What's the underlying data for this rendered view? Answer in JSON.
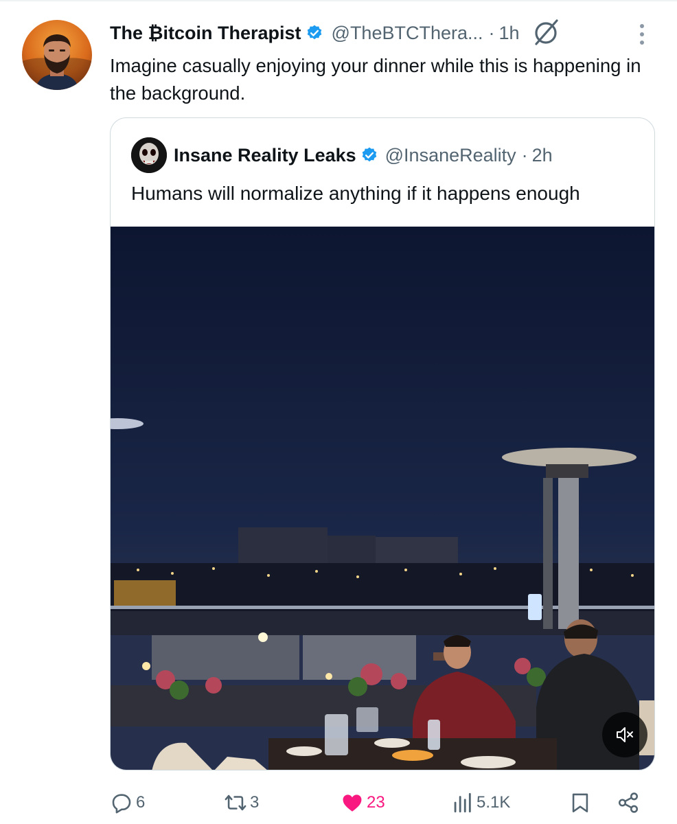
{
  "tweet": {
    "author_name": "The ₿itcoin Therapist",
    "handle": "@TheBTCThera...",
    "separator": "·",
    "time": "1h",
    "text": "Imagine casually enjoying your dinner while this is happening in the background."
  },
  "quoted_tweet": {
    "author_name": "Insane Reality Leaks",
    "handle": "@InsaneReality",
    "separator": "·",
    "time": "2h",
    "text": "Humans will normalize anything if it happens enough"
  },
  "media": {
    "type": "video",
    "muted": true
  },
  "actions": {
    "replies": "6",
    "reposts": "3",
    "likes": "23",
    "views": "5.1K"
  },
  "colors": {
    "verified": "#1d9bf0",
    "like": "#f91880",
    "secondary_text": "#536471",
    "border": "#cfd9de"
  },
  "icons": [
    "verified-badge-icon",
    "grok-icon",
    "more-icon",
    "mute-icon",
    "reply-icon",
    "repost-icon",
    "like-icon",
    "views-icon",
    "bookmark-icon",
    "share-icon"
  ]
}
